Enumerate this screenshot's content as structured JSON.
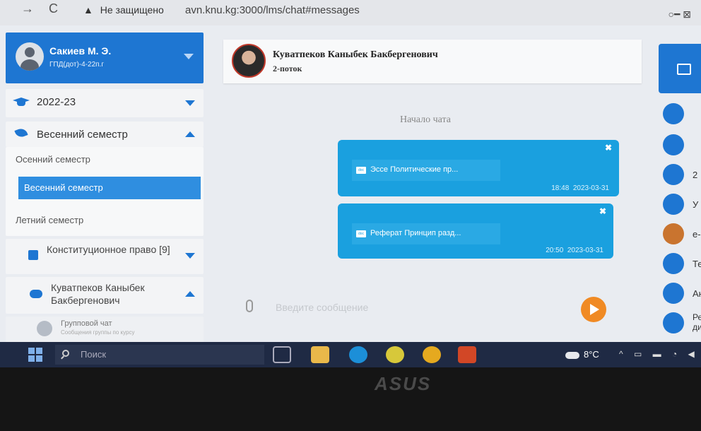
{
  "browser": {
    "security_label": "Не защищено",
    "url": "avn.knu.kg:3000/lms/chat#messages"
  },
  "sidebar": {
    "user": {
      "name": "Сакиев М. Э.",
      "group": "ГПД(дот)-4-22п.г"
    },
    "year": "2022-23",
    "semester_current": "Весенний семестр",
    "semesters": [
      "Осенний семестр",
      "Весенний семестр",
      "Летний семестр"
    ],
    "active_semester_index": 1,
    "course": "Конституционное право [9]",
    "teacher": "Куватпеков Каныбек Бакбергенович",
    "group_chat": {
      "title": "Групповой чат",
      "subtitle": "Сообщения группы по курсу"
    }
  },
  "chat": {
    "header_name": "Куватпеков Каныбек Бакбергенович",
    "header_stream": "2-поток",
    "start_label": "Начало чата",
    "messages": [
      {
        "file": "Эссе Политические пр...",
        "time": "18:48",
        "date": "2023-03-31"
      },
      {
        "file": "Реферат Принцип разд...",
        "time": "20:50",
        "date": "2023-03-31"
      }
    ],
    "input_placeholder": "Введите сообщение"
  },
  "right_rail": {
    "items": [
      "",
      "",
      "2",
      "У",
      "е-",
      "Те",
      "Анк",
      "Реги дисц"
    ]
  },
  "taskbar": {
    "search_label": "Поиск",
    "weather": "8°C"
  },
  "laptop": {
    "brand": "ASUS"
  },
  "colors": {
    "primary": "#1e76d2",
    "bubble": "#1aa0df",
    "send": "#f08a24"
  }
}
